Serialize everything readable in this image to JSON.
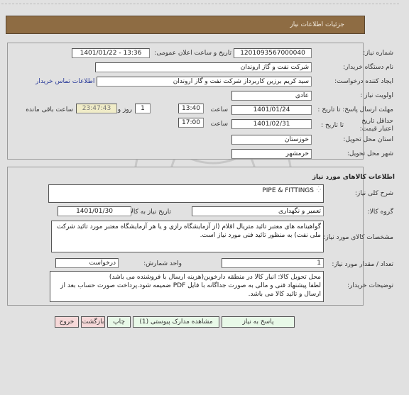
{
  "header": {
    "title": "جزئیات اطلاعات نیاز"
  },
  "need_info": {
    "need_number_label": "شماره نیاز:",
    "need_number": "1201093567000040",
    "announce_label": "تاریخ و ساعت اعلان عمومی:",
    "announce_value": "1401/01/22 - 13:36",
    "buyer_org_label": "نام دستگاه خریدار:",
    "buyer_org": "شرکت نفت و گاز اروندان",
    "creator_label": "ایجاد کننده درخواست:",
    "creator": "سید کریم برزین کاربرداز شرکت نفت و گاز اروندان",
    "contact_link": "اطلاعات تماس خریدار",
    "priority_label": "اولویت نیاز :",
    "priority": "عادی",
    "reply_deadline_label": "مهلت ارسال پاسخ: تا تاریخ :",
    "reply_date": "1401/01/24",
    "time_label": "ساعت",
    "reply_time": "13:40",
    "days": "1",
    "days_label": "روز و",
    "remaining": "23:47:43",
    "remaining_label": "ساعت باقی مانده",
    "validity_label": "حداقل تاریخ اعتبار قیمت:",
    "validity_to_label": "تا تاریخ :",
    "validity_date": "1401/02/31",
    "validity_time": "17:00",
    "province_label": "استان محل تحویل:",
    "province": "خوزستان",
    "city_label": "شهر محل تحویل:",
    "city": "خرمشهر"
  },
  "goods": {
    "section_title": "اطلاعات کالاهای مورد نیاز",
    "summary_label": "شرح کلی نیاز:",
    "summary": "PIPE & FITTINGS",
    "group_label": "گروه کالا:",
    "group": "تعمیر و نگهداری",
    "need_date_label": "تاریخ نیاز به کالا:",
    "need_date": "1401/01/30",
    "specs_label": "مشخصات کالای مورد نیاز:",
    "specs": "گواهینامه های معتبر تائید متریال اقلام (از آزمایشگاه رازی و یا هر آزمایشگاه معتبر مورد تائید شرکت ملی نفت) به منظور تائید فنی مورد نیاز است.",
    "qty_label": "تعداد / مقدار مورد نیاز:",
    "qty": "1",
    "unit_label": "واحد شمارش:",
    "unit": "درخواست",
    "notes_label": "توضیحات خریدار:",
    "notes_line1": "محل تحویل کالا: انبار کالا در منطقه دارخوین(هزینه ارسال با فروشنده می باشد)",
    "notes_line2": "لطفا پیشنهاد فنی و مالی به صورت جداگانه با فایل PDF  ضمیمه شود.پرداخت صورت حساب بعد از ارسال و تائید کالا می باشد."
  },
  "buttons": {
    "reply": "پاسخ به نیاز",
    "attachments": "مشاهده مدارک پیوستی (1)",
    "print": "چاپ",
    "back": "بازگشت",
    "exit": "خروج"
  },
  "colors": {
    "header_bg": "#8e6c43",
    "green_button": "#e8f9e8",
    "red_button": "#f6d8d8",
    "remaining_bg": "#f0ecc8",
    "link": "#2a3b9a"
  }
}
